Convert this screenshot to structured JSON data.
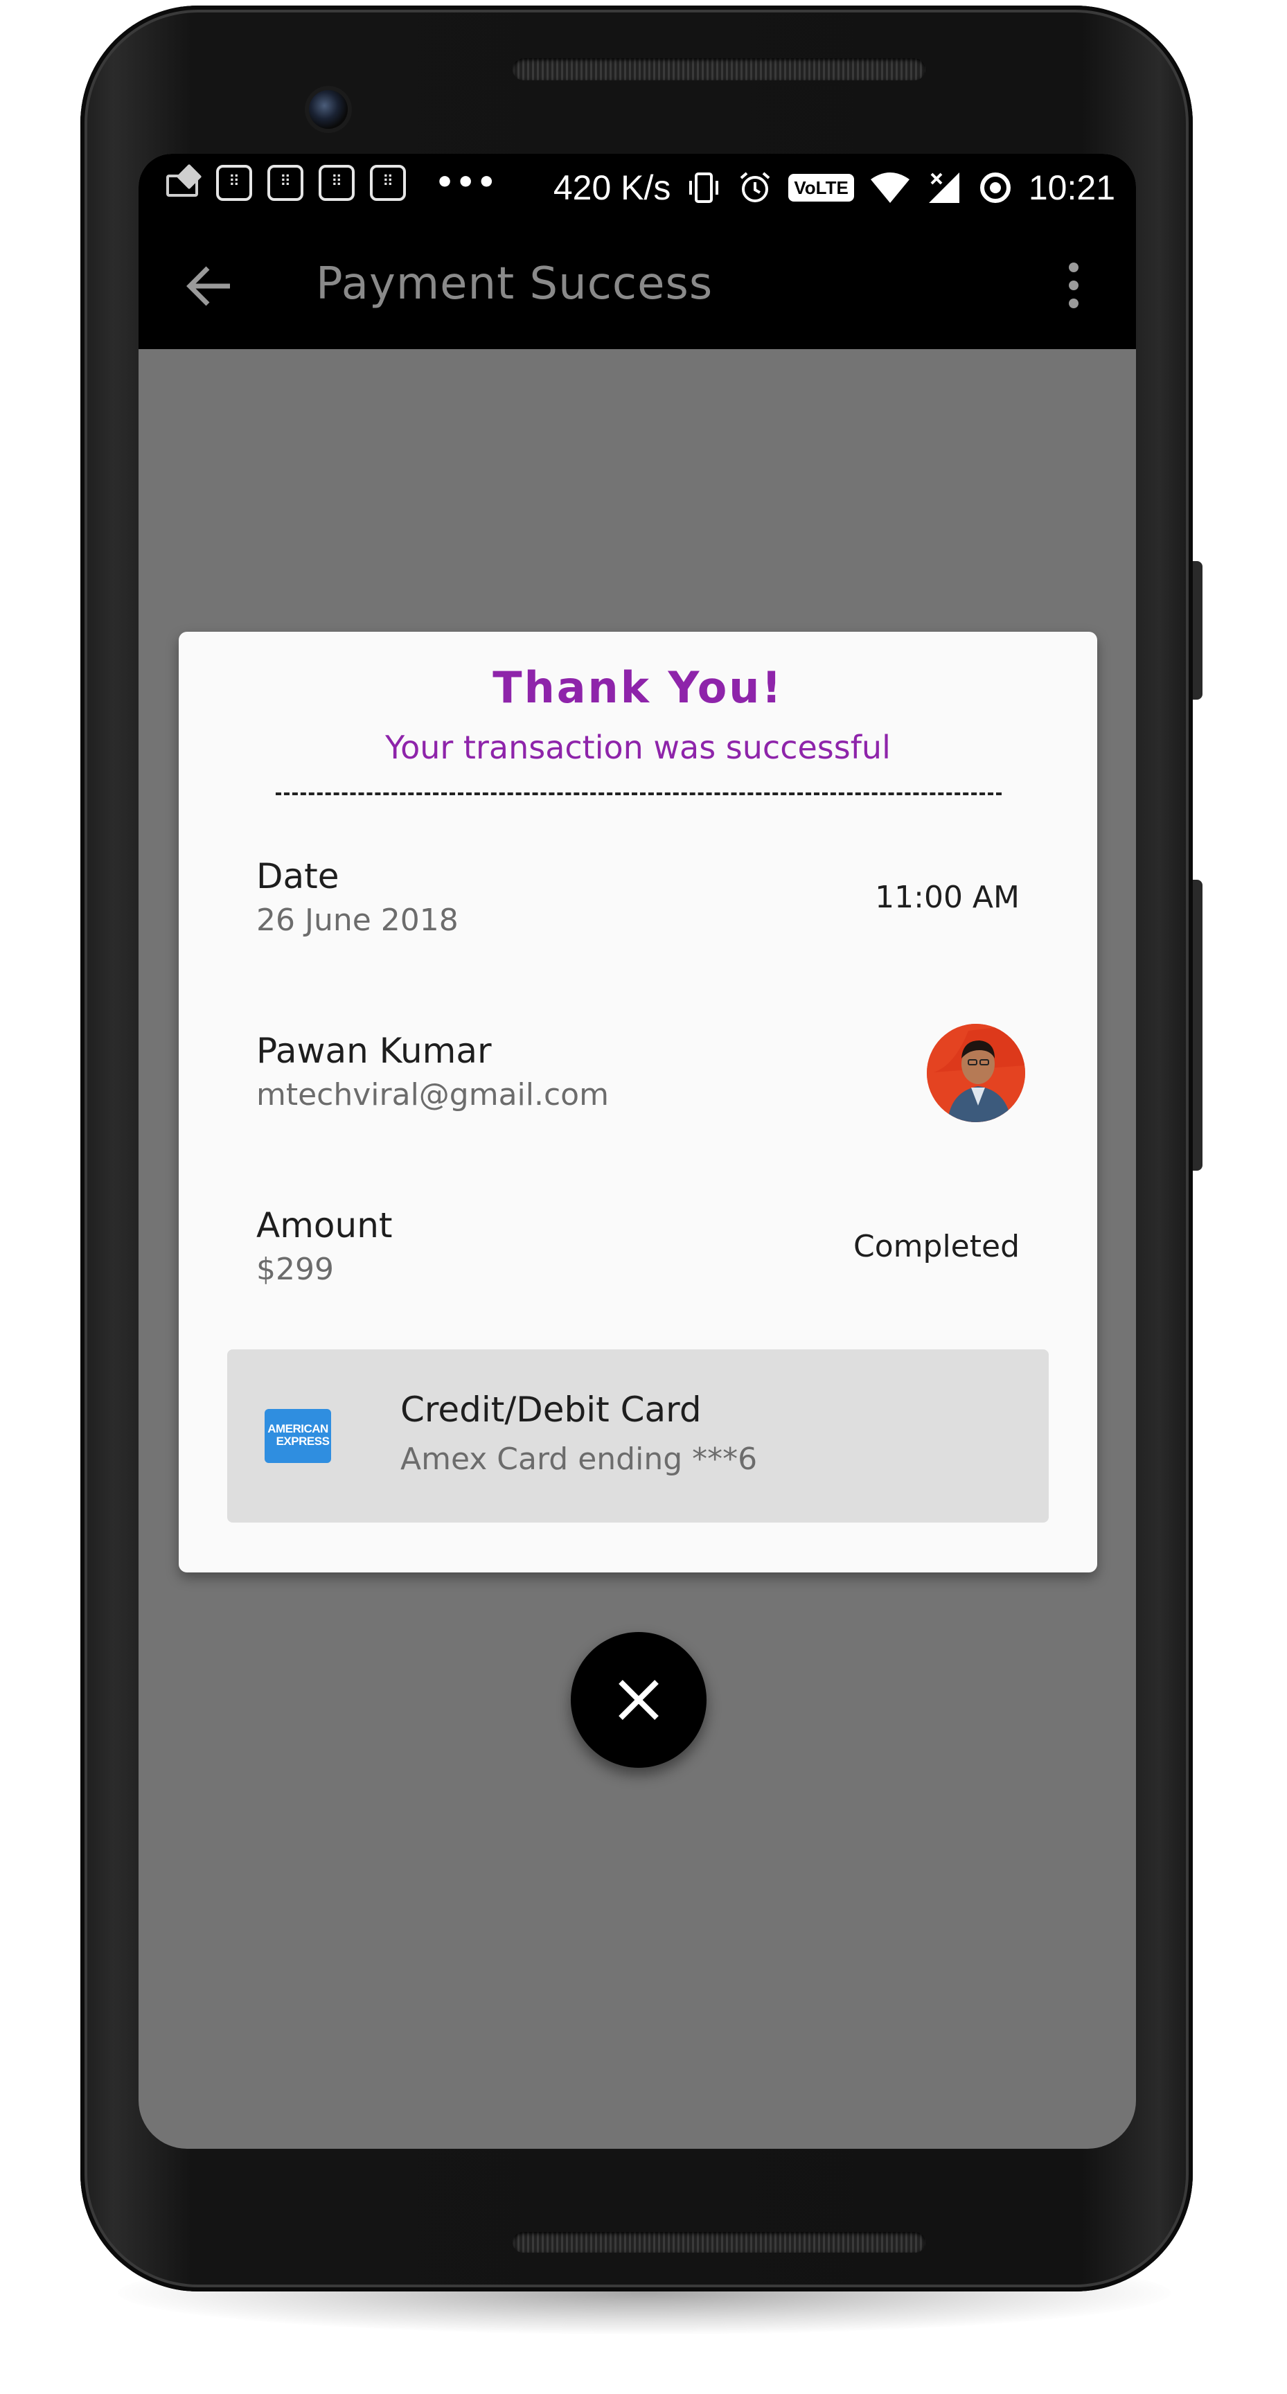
{
  "status_bar": {
    "notification_glyph": "⠿",
    "overflow_dots": "•••",
    "network_speed": "420 K/s",
    "volte_label": "VoLTE",
    "time": "10:21",
    "icons": [
      "email-notification-icon",
      "notification-icon",
      "vibrate-icon",
      "alarm-icon",
      "volte-icon",
      "wifi-icon",
      "signal-icon",
      "sync-icon"
    ]
  },
  "app_bar": {
    "title": "Payment Success",
    "back_icon": "arrow-back-icon",
    "menu_icon": "more-vert-icon"
  },
  "dialog": {
    "title": "Thank You!",
    "subtitle": "Your transaction was successful",
    "date": {
      "label": "Date",
      "value": "26 June 2018",
      "time": "11:00 AM"
    },
    "user": {
      "name": "Pawan Kumar",
      "email": "mtechviral@gmail.com",
      "avatar": "user-avatar"
    },
    "amount": {
      "label": "Amount",
      "value": "$299",
      "status": "Completed"
    },
    "payment_method": {
      "title": "Credit/Debit Card",
      "detail": "Amex Card ending ***6",
      "card_logo_line1": "AMERICAN",
      "card_logo_line2": "EXPRESS"
    }
  },
  "close_button": {
    "icon": "close-icon"
  },
  "colors": {
    "accent": "#8e24aa",
    "overlay": "#747474",
    "card_background": "#fafafa",
    "payment_box": "#dedede",
    "amex_blue": "#2f8ee0"
  }
}
